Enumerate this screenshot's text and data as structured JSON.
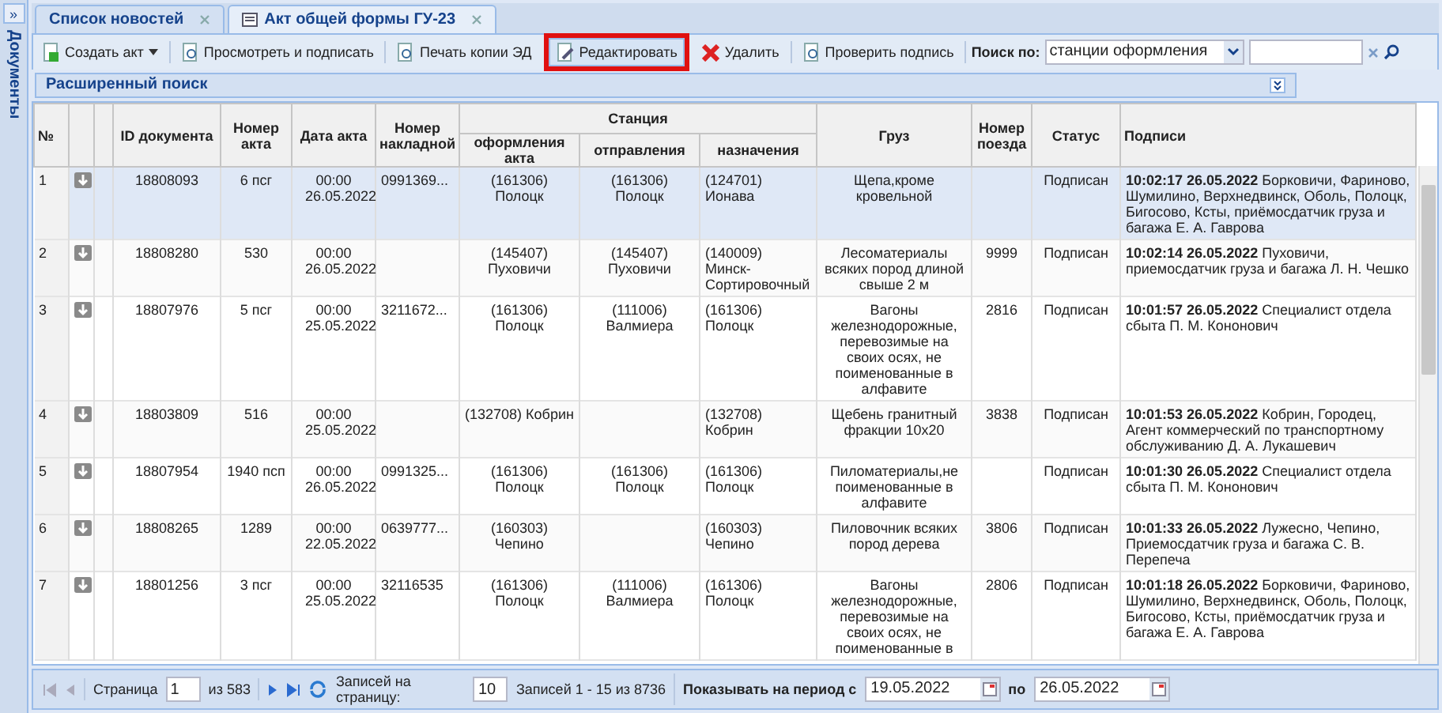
{
  "side_panel": {
    "title": "Документы",
    "toggle": "»"
  },
  "tabs": [
    {
      "label": "Список новостей",
      "selected": false,
      "icon": false
    },
    {
      "label": "Акт общей формы ГУ-23",
      "selected": true,
      "icon": true
    }
  ],
  "toolbar": {
    "buttons": [
      {
        "label": "Создать акт",
        "kind": "menu",
        "highlighted": false
      },
      {
        "label": "Просмотреть и подписать",
        "kind": "doc",
        "highlighted": false
      },
      {
        "label": "Печать копии ЭД",
        "kind": "doc",
        "highlighted": false
      },
      {
        "label": "Редактировать",
        "kind": "edit",
        "highlighted": true
      },
      {
        "label": "Удалить",
        "kind": "delete",
        "highlighted": false
      },
      {
        "label": "Проверить подпись",
        "kind": "doc",
        "highlighted": false
      }
    ],
    "search_label": "Поиск по:",
    "search_by": "станции оформления"
  },
  "advanced_search": {
    "title": "Расширенный поиск"
  },
  "table": {
    "columns": {
      "num": "№",
      "id": "ID документа",
      "act_no": "Номер акта",
      "date": "Дата акта",
      "waybill": "Номер накладной",
      "station": "Станция",
      "st_reg": "оформления акта",
      "st_dep": "отправления",
      "st_dest": "назначения",
      "cargo": "Груз",
      "train": "Номер поезда",
      "status": "Статус",
      "signatures": "Подписи"
    },
    "rows": [
      {
        "num": "1",
        "selected": true,
        "id": "18808093",
        "act_no": "6 псг",
        "date": "00:00 26.05.2022",
        "waybill": "0991369...",
        "st_reg": "(161306) Полоцк",
        "st_dep": "(161306) Полоцк",
        "st_dest": "(124701) Ионава",
        "cargo": "Щепа,кроме кровельной",
        "train": "",
        "status": "Подписан",
        "signatures": "**10:02:17 26.05.2022** Борковичи, Фариново, Шумилино, Верхнедвинск, Оболь, Полоцк, Бигосово, Ксты, приёмосдатчик груза и багажа Е. А. Гаврова"
      },
      {
        "num": "2",
        "selected": false,
        "id": "18808280",
        "act_no": "530",
        "date": "00:00 26.05.2022",
        "waybill": "",
        "st_reg": "(145407) Пуховичи",
        "st_dep": "(145407) Пуховичи",
        "st_dest": "(140009) Минск-Сортировочный",
        "cargo": "Лесоматериалы всяких пород длиной свыше 2 м",
        "train": "9999",
        "status": "Подписан",
        "signatures": "**10:02:14 26.05.2022** Пуховичи, приемосдатчик груза и багажа Л. Н. Чешко"
      },
      {
        "num": "3",
        "selected": false,
        "id": "18807976",
        "act_no": "5 псг",
        "date": "00:00 25.05.2022",
        "waybill": "3211672...",
        "st_reg": "(161306) Полоцк",
        "st_dep": "(111006) Валмиера",
        "st_dest": "(161306) Полоцк",
        "cargo": "Вагоны железнодорожные, перевозимые на своих осях, не поименованные в алфавите",
        "train": "2816",
        "status": "Подписан",
        "signatures": "**10:01:57 26.05.2022** Специалист отдела сбыта П. М. Кононович"
      },
      {
        "num": "4",
        "selected": false,
        "id": "18803809",
        "act_no": "516",
        "date": "00:00 25.05.2022",
        "waybill": "",
        "st_reg": "(132708) Кобрин",
        "st_dep": "",
        "st_dest": "(132708) Кобрин",
        "cargo": "Щебень гранитный фракции 10x20",
        "train": "3838",
        "status": "Подписан",
        "signatures": "**10:01:53 26.05.2022** Кобрин, Городец, Агент коммерческий по транспортному обслуживанию Д. А. Лукашевич"
      },
      {
        "num": "5",
        "selected": false,
        "id": "18807954",
        "act_no": "1940 псп",
        "date": "00:00 26.05.2022",
        "waybill": "0991325...",
        "st_reg": "(161306) Полоцк",
        "st_dep": "(161306) Полоцк",
        "st_dest": "(161306) Полоцк",
        "cargo": "Пиломатериалы,не поименованные в алфавите",
        "train": "",
        "status": "Подписан",
        "signatures": "**10:01:30 26.05.2022** Специалист отдела сбыта П. М. Кононович"
      },
      {
        "num": "6",
        "selected": false,
        "id": "18808265",
        "act_no": "1289",
        "date": "00:00 22.05.2022",
        "waybill": "0639777...",
        "st_reg": "(160303) Чепино",
        "st_dep": "",
        "st_dest": "(160303) Чепино",
        "cargo": "Пиловочник всяких пород дерева",
        "train": "3806",
        "status": "Подписан",
        "signatures": "**10:01:33 26.05.2022** Лужесно, Чепино, Приемосдатчик груза и багажа С. В. Перепеча"
      },
      {
        "num": "7",
        "selected": false,
        "id": "18801256",
        "act_no": "3 псг",
        "date": "00:00 25.05.2022",
        "waybill": "32116535",
        "st_reg": "(161306) Полоцк",
        "st_dep": "(111006) Валмиера",
        "st_dest": "(161306) Полоцк",
        "cargo": "Вагоны железнодорожные, перевозимые на своих осях, не поименованные в",
        "train": "2806",
        "status": "Подписан",
        "signatures": "**10:01:18 26.05.2022** Борковичи, Фариново, Шумилино, Верхнедвинск, Оболь, Полоцк, Бигосово, Ксты, приёмосдатчик груза и багажа Е. А. Гаврова"
      }
    ]
  },
  "pager": {
    "page_label": "Страница",
    "page": "1",
    "of": "из 583",
    "per_page_label": "Записей на страницу:",
    "per_page": "10",
    "records": "Записей 1 - 15 из 8736",
    "period_label": "Показывать на период с",
    "from": "19.05.2022",
    "to_label": "по",
    "to": "26.05.2022"
  }
}
